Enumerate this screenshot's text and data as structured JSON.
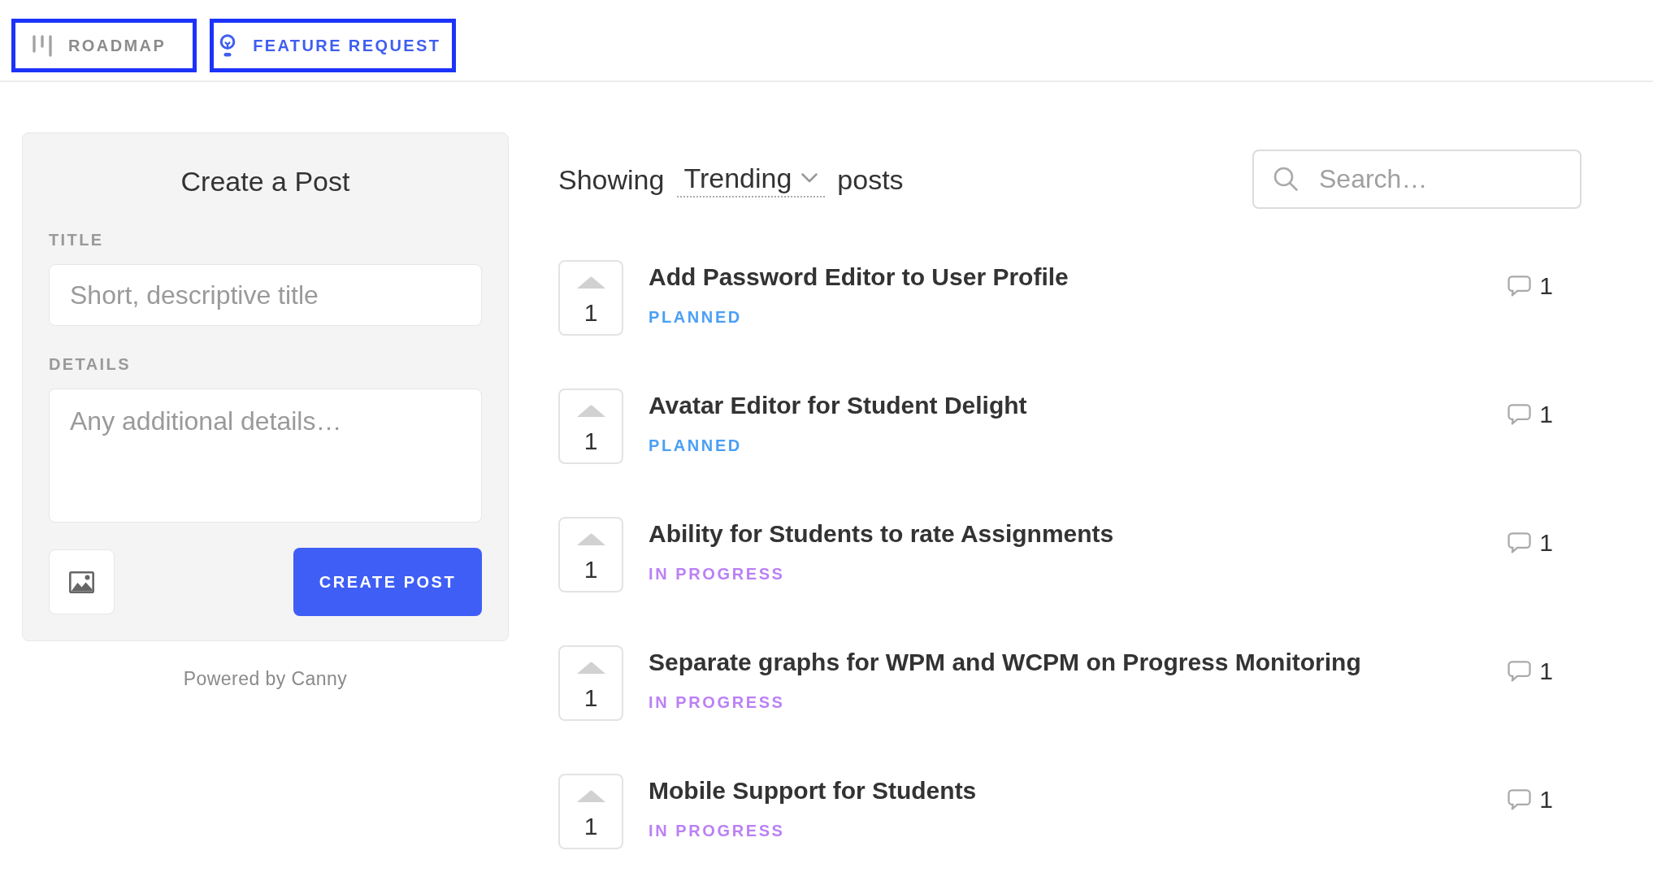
{
  "tabs": [
    {
      "label": "ROADMAP",
      "kind": "roadmap",
      "selected": false
    },
    {
      "label": "FEATURE REQUEST",
      "kind": "feature",
      "selected": true
    }
  ],
  "create_post": {
    "title": "Create a Post",
    "fields": [
      {
        "label": "TITLE",
        "kind": "input",
        "placeholder": "Short, descriptive title"
      },
      {
        "label": "DETAILS",
        "kind": "textarea",
        "placeholder": "Any additional details…"
      }
    ],
    "submit": "CREATE POST"
  },
  "footer": "Powered by Canny",
  "feed": {
    "prefix": "Showing",
    "sort": "Trending",
    "suffix": "posts",
    "search": {
      "placeholder": "Search…"
    },
    "posts": [
      {
        "votes": "1",
        "title": "Add Password Editor to User Profile",
        "status": {
          "label": "PLANNED",
          "color": "#4a9ff5"
        },
        "comments": "1"
      },
      {
        "votes": "1",
        "title": "Avatar Editor for Student Delight",
        "status": {
          "label": "PLANNED",
          "color": "#4a9ff5"
        },
        "comments": "1"
      },
      {
        "votes": "1",
        "title": "Ability for Students to rate Assignments",
        "status": {
          "label": "IN PROGRESS",
          "color": "#bb80f5"
        },
        "comments": "1"
      },
      {
        "votes": "1",
        "title": "Separate graphs for WPM and WCPM on Progress Monitoring",
        "status": {
          "label": "IN PROGRESS",
          "color": "#bb80f5"
        },
        "comments": "1"
      },
      {
        "votes": "1",
        "title": "Mobile Support for Students",
        "status": {
          "label": "IN PROGRESS",
          "color": "#bb80f5"
        },
        "comments": "1"
      }
    ]
  }
}
